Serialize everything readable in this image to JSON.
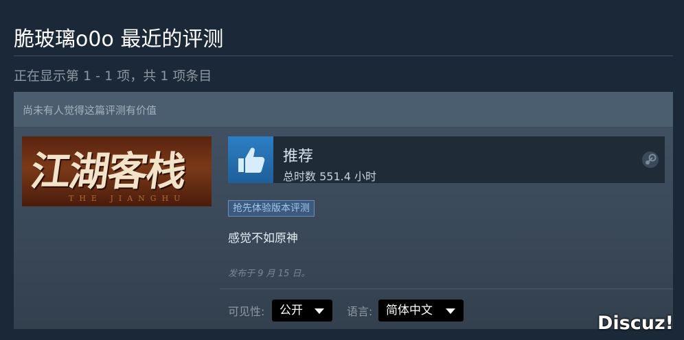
{
  "header": {
    "title": "脆玻璃o0o 最近的评测",
    "subtitle": "正在显示第 1 - 1 项，共 1 项条目"
  },
  "review": {
    "helpful_text": "尚未有人觉得这篇评测有价值",
    "game_capsule": {
      "title": "江湖客栈",
      "subtitle": "THE JIANGHU",
      "stamp": "客栈"
    },
    "recommendation": "推荐",
    "hours": "总时数 551.4 小时",
    "early_access_badge": "抢先体验版本评测",
    "text": "感觉不如原神",
    "posted": "发布于 9 月 15 日。",
    "visibility_label": "可见性:",
    "visibility_value": "公开",
    "language_label": "语言:",
    "language_value": "简体中文"
  },
  "watermark": "Discuz!",
  "colors": {
    "background": "#1b2838",
    "thumb_blue": "#2c7fc4",
    "badge_blue": "#9ec7f0"
  },
  "icons": {
    "thumb": "thumbs-up-icon",
    "platform": "steam-icon",
    "dropdown": "chevron-down-icon"
  }
}
